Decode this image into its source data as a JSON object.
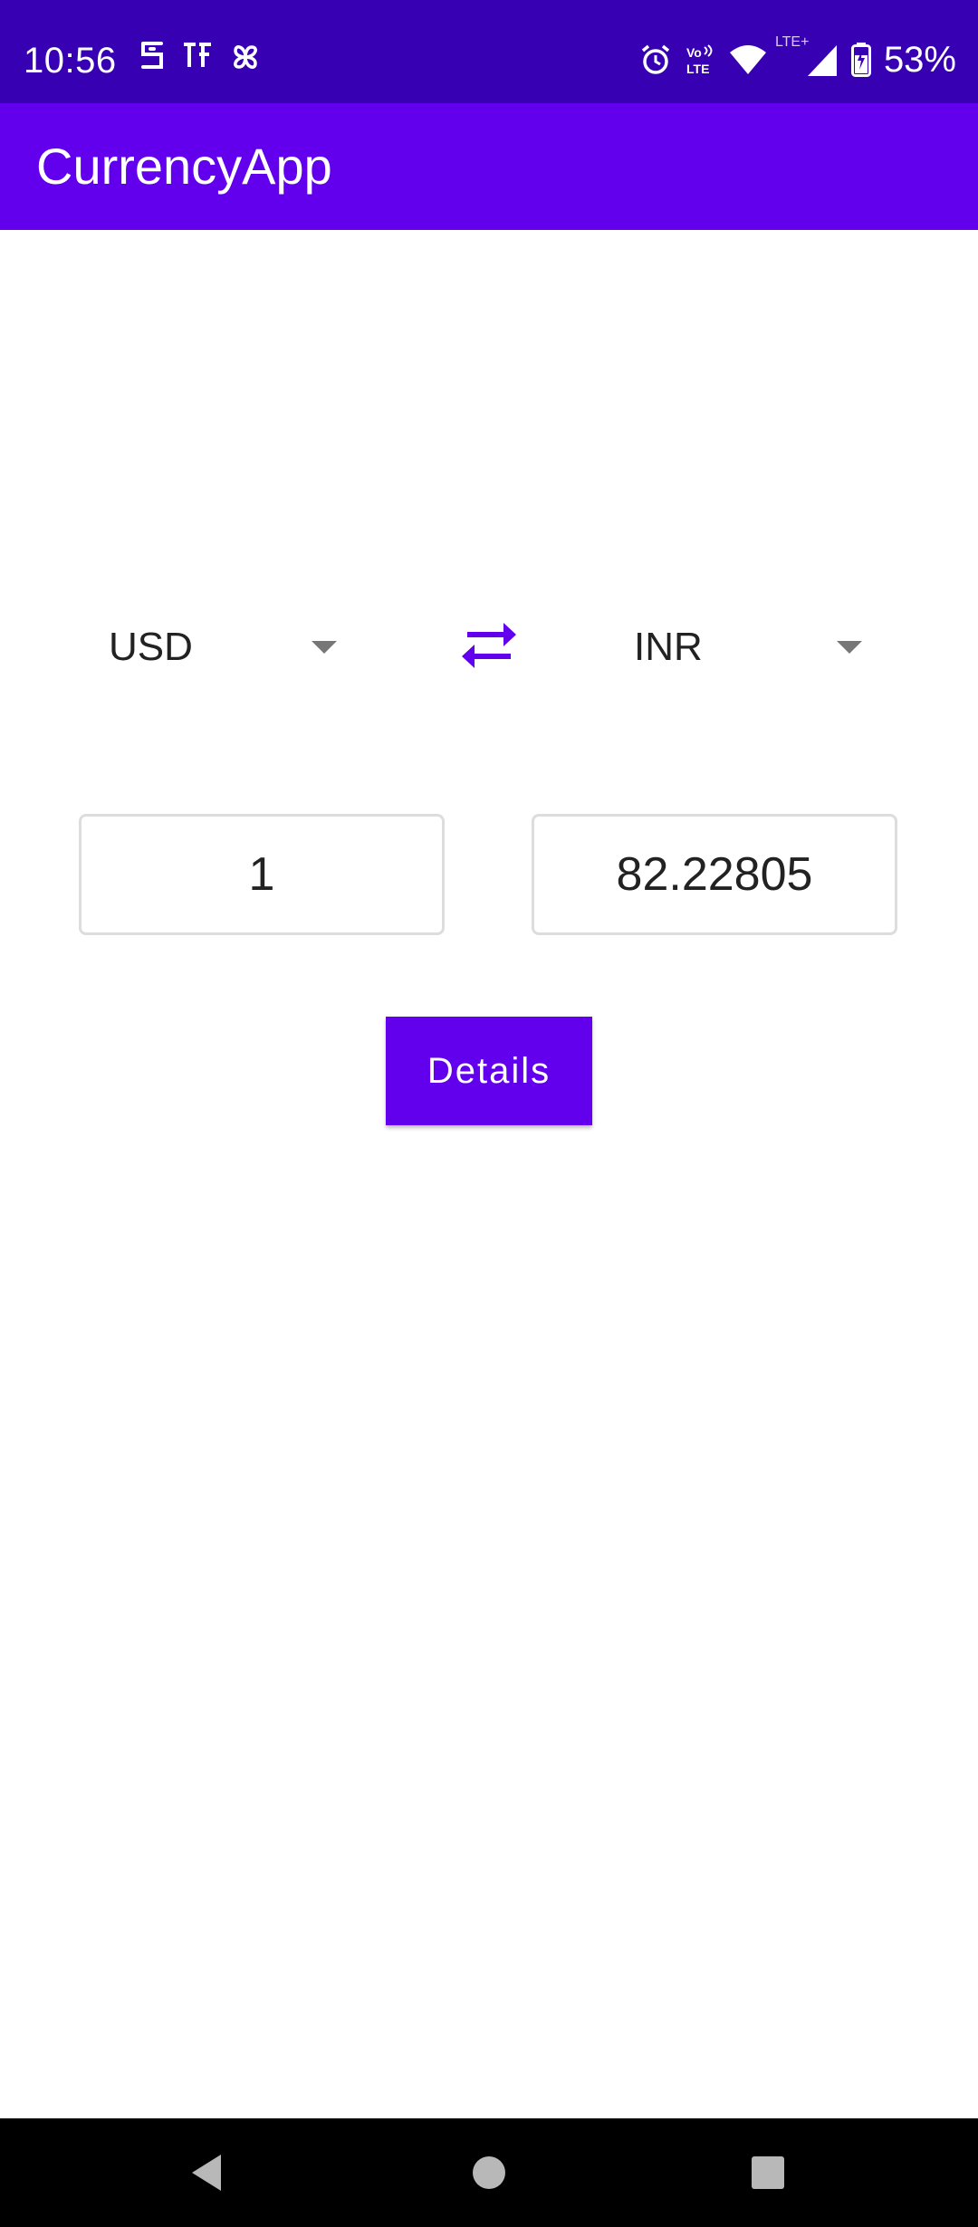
{
  "status_bar": {
    "time": "10:56",
    "left_icons": [
      "s-app-icon",
      "tf-app-icon",
      "pinwheel-app-icon"
    ],
    "right_icons": [
      "alarm-icon",
      "volte-icon",
      "wifi-icon",
      "lte-signal-icon",
      "battery-charging-icon"
    ],
    "network_label": "LTE+",
    "volte_label_top": "Vo",
    "volte_label_bottom": "LTE",
    "battery_percent": "53%",
    "background_color": "#3700b3"
  },
  "app_bar": {
    "title": "CurrencyApp",
    "background_color": "#6200ee"
  },
  "converter": {
    "from_currency": "USD",
    "to_currency": "INR",
    "from_amount": "1",
    "to_amount": "82.22805",
    "swap_icon": "swap-horizontal-icon",
    "accent_color": "#6200ee"
  },
  "details_button": {
    "label": "Details"
  },
  "nav_bar": {
    "icons": [
      "back-icon",
      "home-icon",
      "recents-icon"
    ]
  }
}
